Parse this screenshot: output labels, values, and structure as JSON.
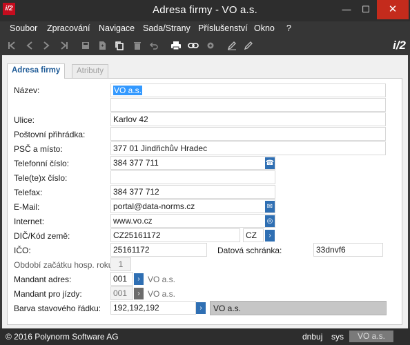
{
  "window": {
    "title": "Adresa firmy - VO a.s.",
    "app_icon": "i/2",
    "minimize_glyph": "—",
    "maximize_glyph": "☐",
    "close_glyph": "✕"
  },
  "menu": [
    "Soubor",
    "Zpracování",
    "Navigace",
    "Sada/Strany",
    "Příslušenství",
    "Okno",
    "?"
  ],
  "toolbar": {
    "icons": [
      "first-record-icon",
      "previous-record-icon",
      "next-record-icon",
      "last-record-icon",
      "save-icon",
      "new-document-icon",
      "copy-icon",
      "delete-icon",
      "undo-icon",
      "print-icon",
      "link-icon",
      "settings-icon",
      "edit-icon",
      "write-icon"
    ],
    "logo": "i/2"
  },
  "tabs": [
    {
      "label": "Adresa firmy",
      "active": true
    },
    {
      "label": "Atributy",
      "active": false
    }
  ],
  "form": {
    "nazev": {
      "label": "Název:",
      "value": "VO a.s.",
      "value2": ""
    },
    "ulice": {
      "label": "Ulice:",
      "value": "Karlov 42"
    },
    "postovni_prihradka": {
      "label": "Poštovní přihrádka:",
      "value": ""
    },
    "psc_misto": {
      "label": "PSČ a místo:",
      "value": "377 01  Jindřichův Hradec"
    },
    "telefon": {
      "label": "Telefonní číslo:",
      "value": "384 377 711"
    },
    "teletex": {
      "label": "Tele(te)x číslo:",
      "value": ""
    },
    "telefax": {
      "label": "Telefax:",
      "value": "384 377 712"
    },
    "email": {
      "label": "E-Mail:",
      "value": "portal@data-norms.cz"
    },
    "internet": {
      "label": "Internet:",
      "value": "www.vo.cz"
    },
    "dic": {
      "label": "DIČ/Kód země:",
      "value": "CZ25161172",
      "country": "CZ"
    },
    "ico": {
      "label": "IČO:",
      "value": "25161172"
    },
    "datova_schranka": {
      "label": "Datová schránka:",
      "value": "33dnvf6"
    },
    "obdobi": {
      "label": "Období začátku hosp. roku:",
      "value": "1"
    },
    "mandant_adres": {
      "label": "Mandant adres:",
      "value": "001",
      "note": "VO a.s."
    },
    "mandant_jizdy": {
      "label": "Mandant pro jízdy:",
      "value": "001",
      "note": "VO a.s."
    },
    "barva": {
      "label": "Barva stavového řádku:",
      "value": "192,192,192",
      "preview": "VO a.s.",
      "preview_color": "#c0c0c0"
    }
  },
  "statusbar": {
    "copyright": "© 2016 Polynorm Software AG",
    "user": "dnbuj",
    "system": "sys",
    "company": "VO a.s."
  },
  "colors": {
    "accent": "#2f6fb3",
    "close_button": "#c42b1c",
    "titlebar": "#2d2d2d",
    "selection": "#3399ff"
  }
}
